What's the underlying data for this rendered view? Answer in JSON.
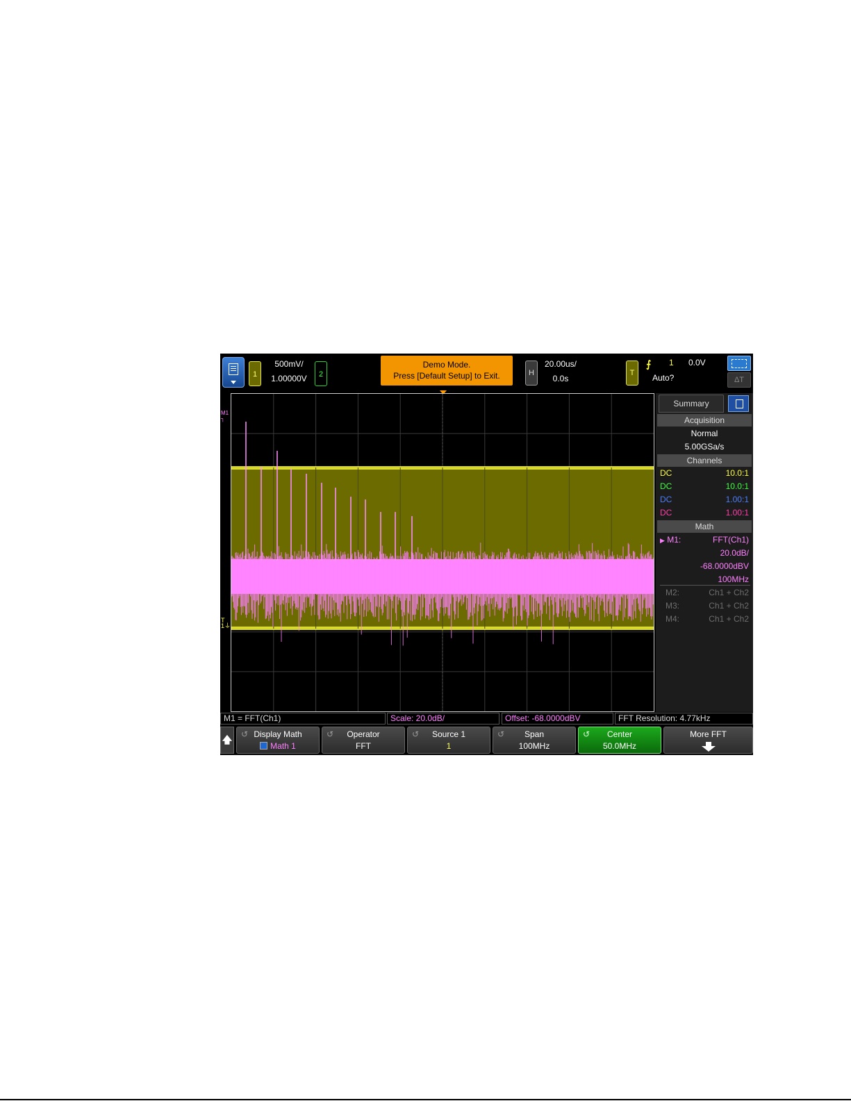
{
  "topbar": {
    "ch1_badge": "1",
    "ch1_scale": "500mV/",
    "ch1_offset": "1.00000V",
    "ch2_badge": "2",
    "demo_line1": "Demo Mode.",
    "demo_line2": "Press [Default Setup] to Exit.",
    "h_badge": "H",
    "time_scale": "20.00us/",
    "time_delay": "0.0s",
    "t_badge": "T",
    "trigger_edge_icon": "rising-edge-icon",
    "trigger_source": "1",
    "trigger_level": "0.0V",
    "trigger_mode": "Auto?",
    "delta_label": "ΔT"
  },
  "side_panel": {
    "tab": "Summary",
    "acquisition_header": "Acquisition",
    "acquisition_mode": "Normal",
    "sample_rate": "5.00GSa/s",
    "channels_header": "Channels",
    "channels": [
      {
        "coupling": "DC",
        "probe": "10.0:1",
        "color": "#ffff40"
      },
      {
        "coupling": "DC",
        "probe": "10.0:1",
        "color": "#40ff40"
      },
      {
        "coupling": "DC",
        "probe": "1.00:1",
        "color": "#4a7dff"
      },
      {
        "coupling": "DC",
        "probe": "1.00:1",
        "color": "#ff3fa8"
      }
    ],
    "math_header": "Math",
    "m1_label": "M1:",
    "m1_func": "FFT(Ch1)",
    "m1_scale": "20.0dB/",
    "m1_offset": "-68.0000dBV",
    "m1_span": "100MHz",
    "other_math": [
      {
        "label": "M2:",
        "func": "Ch1 + Ch2"
      },
      {
        "label": "M3:",
        "func": "Ch1 + Ch2"
      },
      {
        "label": "M4:",
        "func": "Ch1 + Ch2"
      }
    ]
  },
  "status_line": {
    "math_def": "M1 = FFT(Ch1)",
    "scale": "Scale: 20.0dB/",
    "offset": "Offset: -68.0000dBV",
    "resolution": "FFT Resolution: 4.77kHz"
  },
  "softkeys": {
    "back_icon": "up-arrow-icon",
    "display_math_label": "Display Math",
    "display_math_value": "Math 1",
    "operator_label": "Operator",
    "operator_value": "FFT",
    "source_label": "Source 1",
    "source_value": "1",
    "span_label": "Span",
    "span_value": "100MHz",
    "center_label": "Center",
    "center_value": "50.0MHz",
    "more_label": "More FFT"
  },
  "colors": {
    "ch1": "#ffff40",
    "math": "#ff80ff",
    "demo_banner": "#f29500",
    "active_softkey": "#1ca81c"
  }
}
